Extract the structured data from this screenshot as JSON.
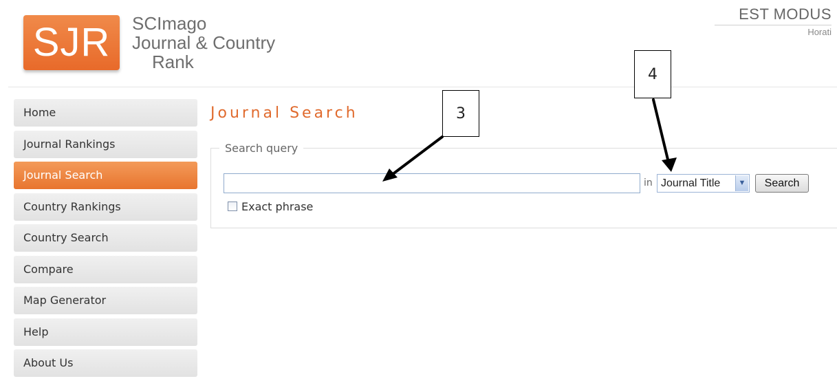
{
  "logo": {
    "text": "SJR"
  },
  "site": {
    "line1": "SCImago",
    "line2": "Journal & Country",
    "line3": "Rank"
  },
  "motto": {
    "main": "EST MODUS",
    "sub": "Horati"
  },
  "nav": {
    "items": [
      {
        "label": "Home"
      },
      {
        "label": "Journal Rankings"
      },
      {
        "label": "Journal Search",
        "active": true
      },
      {
        "label": "Country Rankings"
      },
      {
        "label": "Country Search"
      },
      {
        "label": "Compare"
      },
      {
        "label": "Map Generator"
      },
      {
        "label": "Help"
      },
      {
        "label": "About Us"
      }
    ]
  },
  "page": {
    "title": "Journal Search"
  },
  "search": {
    "legend": "Search query",
    "query_value": "",
    "in_label": "in",
    "field_selected": "Journal Title",
    "button_label": "Search",
    "exact_label": "Exact phrase",
    "exact_checked": false
  },
  "callouts": {
    "c3": "3",
    "c4": "4"
  },
  "colors": {
    "accent": "#e8752f",
    "title": "#e06a2d"
  }
}
